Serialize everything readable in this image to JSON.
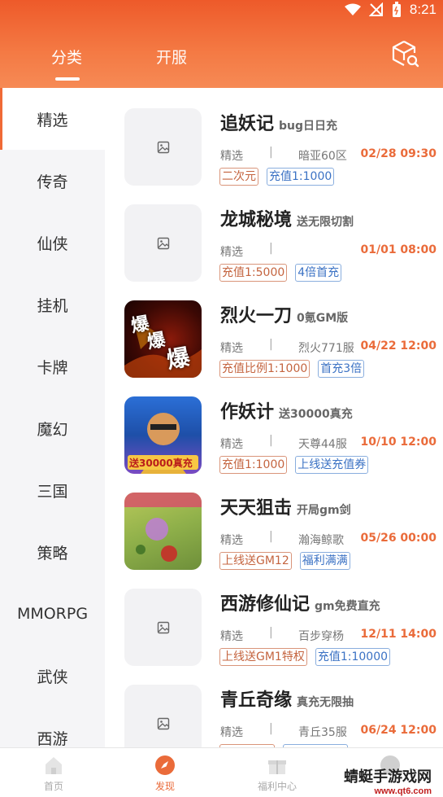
{
  "status_bar": {
    "time": "8:21"
  },
  "header": {
    "tabs": [
      {
        "label": "分类"
      },
      {
        "label": "开服"
      }
    ]
  },
  "sidebar": {
    "items": [
      {
        "label": "精选"
      },
      {
        "label": "传奇"
      },
      {
        "label": "仙侠"
      },
      {
        "label": "挂机"
      },
      {
        "label": "卡牌"
      },
      {
        "label": "魔幻"
      },
      {
        "label": "三国"
      },
      {
        "label": "策略"
      },
      {
        "label": "MMORPG"
      },
      {
        "label": "武侠"
      },
      {
        "label": "西游"
      }
    ]
  },
  "games": [
    {
      "name": "追妖记",
      "subtitle": "bug日日充",
      "category": "精选",
      "server": "暗亚60区",
      "time": "02/28 09:30",
      "tags": [
        "二次元",
        "充值1:1000"
      ]
    },
    {
      "name": "龙城秘境",
      "subtitle": "送无限切割",
      "category": "精选",
      "server": "",
      "time": "01/01 08:00",
      "tags": [
        "充值1:5000",
        "4倍首充"
      ]
    },
    {
      "name": "烈火一刀",
      "subtitle": "0氪GM版",
      "category": "精选",
      "server": "烈火771服",
      "time": "04/22 12:00",
      "tags": [
        "充值比例1:1000",
        "首充3倍"
      ]
    },
    {
      "name": "作妖计",
      "subtitle": "送30000真充",
      "category": "精选",
      "server": "天尊44服",
      "time": "10/10 12:00",
      "tags": [
        "充值1:1000",
        "上线送充值券"
      ]
    },
    {
      "name": "天天狙击",
      "subtitle": "开局gm剑",
      "category": "精选",
      "server": "瀚海鲸歌",
      "time": "05/26 00:00",
      "tags": [
        "上线送GM12",
        "福利满满"
      ]
    },
    {
      "name": "西游修仙记",
      "subtitle": "gm免费直充",
      "category": "精选",
      "server": "百步穿杨",
      "time": "12/11 14:00",
      "tags": [
        "上线送GM1特权",
        "充值1:10000"
      ]
    },
    {
      "name": "青丘奇缘",
      "subtitle": "真充无限抽",
      "category": "精选",
      "server": "青丘35服",
      "time": "06/24 12:00",
      "tags": [
        "",
        ""
      ]
    }
  ],
  "thumb_texts": {
    "game3": "爆",
    "game4": "送30000真充"
  },
  "bottom_nav": {
    "items": [
      {
        "label": "首页"
      },
      {
        "label": "发现"
      },
      {
        "label": "福利中心"
      }
    ]
  },
  "watermark": {
    "title": "蜻蜓手游戏网",
    "url": "www.qt6.com"
  },
  "colors": {
    "accent": "#ea6b3a",
    "header": "#f06a36",
    "tag_orange": "#c4643f",
    "tag_blue": "#3b72c4"
  }
}
